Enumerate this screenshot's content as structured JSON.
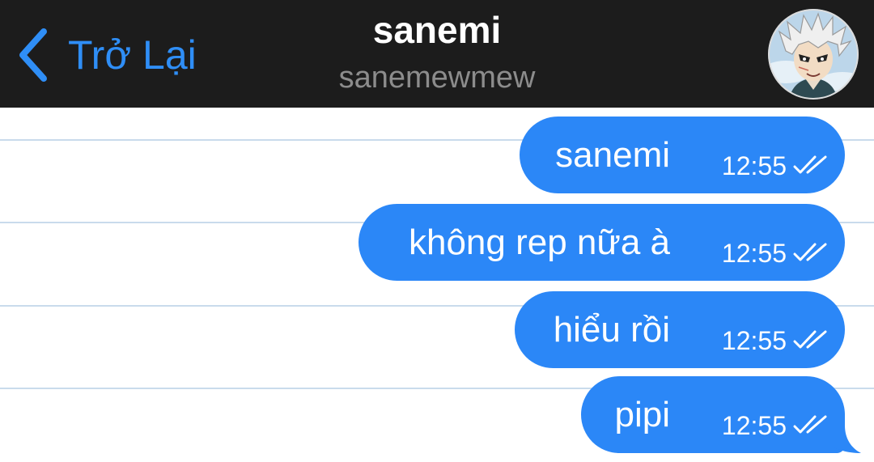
{
  "header": {
    "back_label": "Trở Lại",
    "contact_name": "sanemi",
    "contact_handle": "sanemewmew"
  },
  "messages": [
    {
      "text": "sanemi",
      "time": "12:55",
      "status": "read-double-check"
    },
    {
      "text": "không rep nữa à",
      "time": "12:55",
      "status": "read-double-check"
    },
    {
      "text": "hiểu rồi",
      "time": "12:55",
      "status": "read-double-check"
    },
    {
      "text": "pipi",
      "time": "12:55",
      "status": "read-double-check"
    }
  ],
  "icons": {
    "back": "chevron-left-icon",
    "status": "double-check-icon"
  },
  "colors": {
    "header_bg": "#1c1c1c",
    "accent": "#2f8ef6",
    "bubble": "#2b87f7",
    "chat_bg": "#ffffff",
    "rule_line": "#c9dbec"
  }
}
